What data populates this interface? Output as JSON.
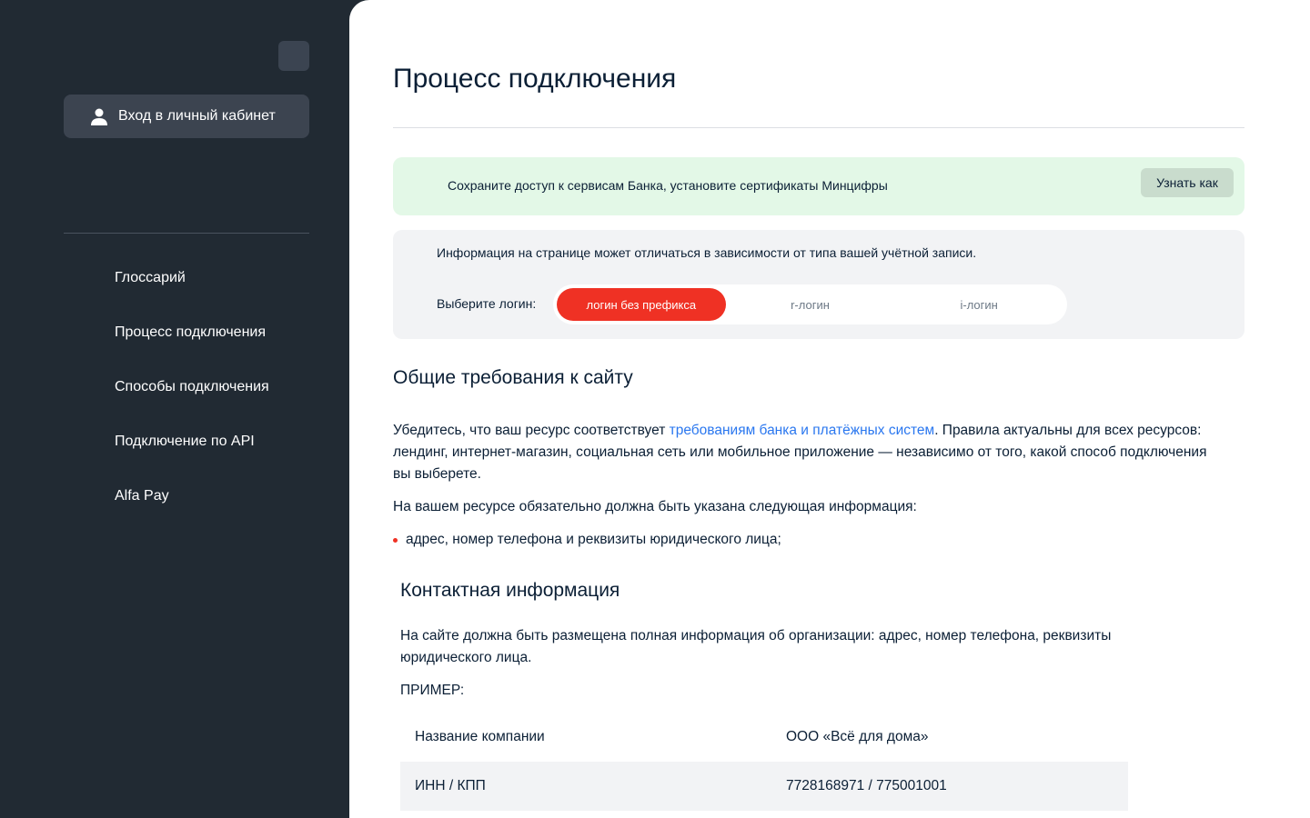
{
  "sidebar": {
    "login_button": "Вход в личный кабинет",
    "nav": [
      {
        "label": "Глоссарий"
      },
      {
        "label": "Процесс подключения"
      },
      {
        "label": "Способы подключения"
      },
      {
        "label": "Подключение по API"
      },
      {
        "label": "Alfa Pay"
      }
    ]
  },
  "main": {
    "title": "Процесс подключения",
    "notice": {
      "text": "Сохраните доступ к сервисам Банка, установите сертификаты Минцифры",
      "button": "Узнать как"
    },
    "info": {
      "text": "Информация на странице может отличаться в зависимости от типа вашей учётной записи.",
      "select_label": "Выберите логин:",
      "options": [
        "логин без префикса",
        "r-логин",
        "i-логин"
      ],
      "selected": "логин без префикса"
    },
    "section1": {
      "heading": "Общие требования к сайту",
      "para1_before": "Убедитесь, что ваш ресурс соответствует ",
      "para1_link": "требованиям банка и платёжных систем",
      "para1_after": ". Правила актуальны для всех ресурсов: лендинг, интернет-магазин, социальная сеть или мобильное приложение — независимо от того, какой способ подключения вы выберете.",
      "para2": "На вашем ресурсе обязательно должна быть указана следующая информация:",
      "bullet1": "адрес, номер телефона и реквизиты юридического лица;"
    },
    "section2": {
      "heading": "Контактная информация",
      "para": "На сайте должна быть размещена полная информация об организации: адрес, номер телефона, реквизиты юридического лица.",
      "example_label": "ПРИМЕР:",
      "table": [
        {
          "label": "Название компании",
          "value": "ООО «Всё для дома»"
        },
        {
          "label": "ИНН / КПП",
          "value": "7728168971 / 775001001"
        }
      ]
    }
  },
  "colors": {
    "sidebar_bg": "#212a33",
    "accent_red": "#ef3124",
    "link_blue": "#2a77ef",
    "notice_green": "#e3f8e7"
  }
}
